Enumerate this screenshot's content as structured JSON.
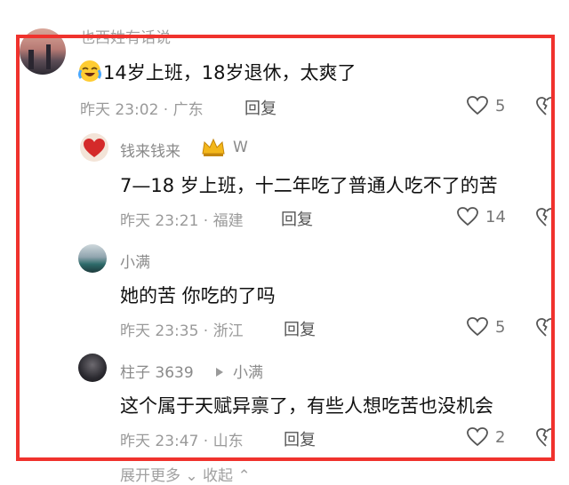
{
  "partial_top_name": "也西姓有话说·",
  "partial_bottom_text": "展开更多 ⌄   收起 ⌃",
  "accent_color": "#f0322d",
  "comments": [
    {
      "name": "",
      "emoji": "laughing-crying-emoji",
      "text": "14岁上班，18岁退休，太爽了",
      "meta": "昨天 23:02 · 广东",
      "reply": "回复",
      "likes": "5"
    },
    {
      "name": "钱来钱来",
      "badge": "crown-icon",
      "badge_text": "W",
      "text": "7—18 岁上班，十二年吃了普通人吃不了的苦",
      "meta": "昨天 23:21 · 福建",
      "reply": "回复",
      "likes": "14"
    },
    {
      "name": "小满",
      "text": "她的苦  你吃的了吗",
      "meta": "昨天 23:35 · 浙江",
      "reply": "回复",
      "likes": "5"
    },
    {
      "name": "柱子 3639",
      "reply_to": "小满",
      "text": "这个属于天赋异禀了，有些人想吃苦也没机会",
      "meta": "昨天 23:47 · 山东",
      "reply": "回复",
      "likes": "2"
    }
  ]
}
